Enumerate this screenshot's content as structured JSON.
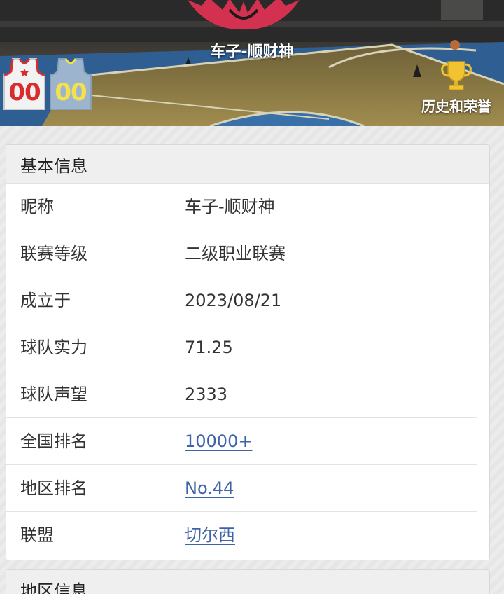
{
  "header": {
    "team_name": "车子-顺财神",
    "honors_label": "历史和荣誉",
    "home_jersey": {
      "number": "00",
      "color": "#f2f2f2",
      "number_color": "#d92c2c"
    },
    "away_jersey": {
      "number": "00",
      "color": "#9db4cf",
      "number_color": "#f3e24a"
    },
    "icons": {
      "logo": "team-logo-icon",
      "trophy": "trophy-icon"
    }
  },
  "basic_info": {
    "title": "基本信息",
    "rows": [
      {
        "label": "昵称",
        "value": "车子-顺财神",
        "link": false
      },
      {
        "label": "联赛等级",
        "value": "二级职业联赛",
        "link": false
      },
      {
        "label": "成立于",
        "value": "2023/08/21",
        "link": false
      },
      {
        "label": "球队实力",
        "value": "71.25",
        "link": false
      },
      {
        "label": "球队声望",
        "value": "2333",
        "link": false
      },
      {
        "label": "全国排名",
        "value": "10000+",
        "link": true
      },
      {
        "label": "地区排名",
        "value": "No.44",
        "link": true
      },
      {
        "label": "联盟",
        "value": "切尔西",
        "link": true
      }
    ]
  },
  "region_info": {
    "title": "地区信息"
  },
  "colors": {
    "link": "#3f63a8",
    "card_header_bg": "#efefef",
    "court_wood": "#9c8a4c",
    "court_blue": "#3a70a8"
  }
}
